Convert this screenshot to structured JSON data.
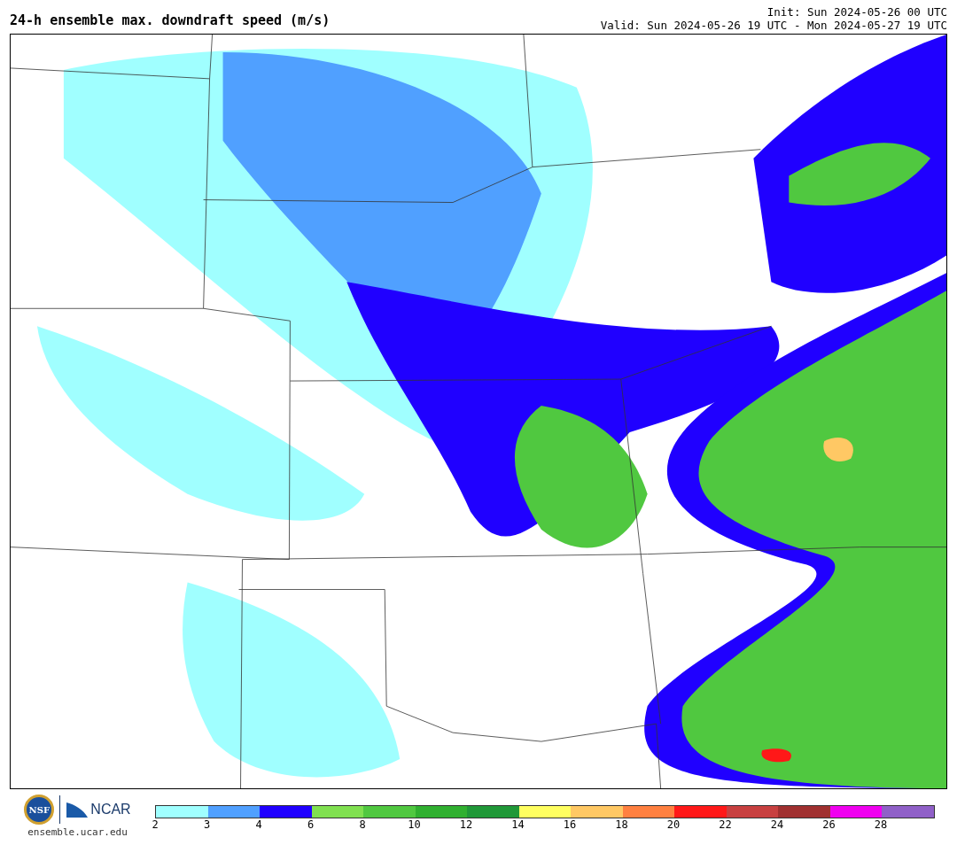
{
  "header": {
    "title": "24-h ensemble max. downdraft speed (m/s)",
    "init": "Init: Sun 2024-05-26 00 UTC",
    "valid": "Valid: Sun 2024-05-26 19 UTC - Mon 2024-05-27 19 UTC"
  },
  "footer": {
    "nsf_logo": "NSF",
    "ncar_logo": "NCAR",
    "url": "ensemble.ucar.edu"
  },
  "colorbar": [
    {
      "label": "2",
      "color": "#a0ffff"
    },
    {
      "label": "3",
      "color": "#50a0ff"
    },
    {
      "label": "4",
      "color": "#2000ff"
    },
    {
      "label": "6",
      "color": "#80e050"
    },
    {
      "label": "8",
      "color": "#50c840"
    },
    {
      "label": "10",
      "color": "#30b030"
    },
    {
      "label": "12",
      "color": "#209838"
    },
    {
      "label": "14",
      "color": "#ffff60"
    },
    {
      "label": "16",
      "color": "#ffc864"
    },
    {
      "label": "18",
      "color": "#ff8040"
    },
    {
      "label": "20",
      "color": "#ff1818"
    },
    {
      "label": "22",
      "color": "#c84040"
    },
    {
      "label": "24",
      "color": "#a03030"
    },
    {
      "label": "26",
      "color": "#f000f0"
    },
    {
      "label": "28",
      "color": "#9060c8"
    }
  ]
}
